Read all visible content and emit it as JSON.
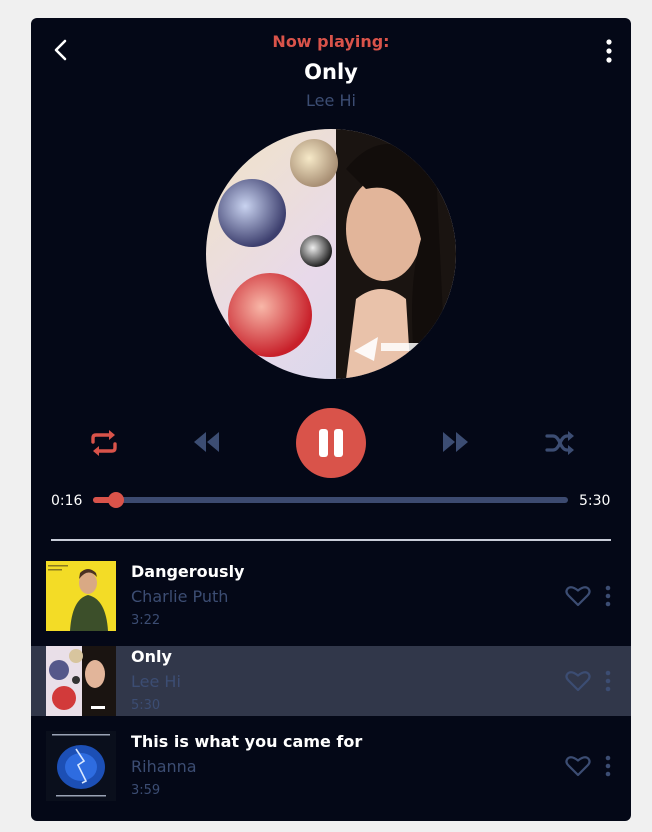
{
  "header": {
    "now_playing_label": "Now playing:",
    "title": "Only",
    "artist": "Lee Hi"
  },
  "icons": {
    "back": "chevron-left-icon",
    "menu": "more-vertical-icon",
    "repeat": "repeat-icon",
    "rewind": "rewind-icon",
    "pause": "pause-icon",
    "forward": "fast-forward-icon",
    "shuffle": "shuffle-icon",
    "heart": "heart-icon"
  },
  "progress": {
    "current": "0:16",
    "total": "5:30",
    "fraction": 0.048
  },
  "playlist": [
    {
      "title": "Dangerously",
      "artist": "Charlie Puth",
      "duration": "3:22",
      "active": false
    },
    {
      "title": "Only",
      "artist": "Lee Hi",
      "duration": "5:30",
      "active": true
    },
    {
      "title": "This is what you came for",
      "artist": "Rihanna",
      "duration": "3:59",
      "active": false
    }
  ],
  "colors": {
    "accent": "#d9534a",
    "background": "#040817",
    "muted": "#3c4d73",
    "active_row": "#31374a"
  }
}
